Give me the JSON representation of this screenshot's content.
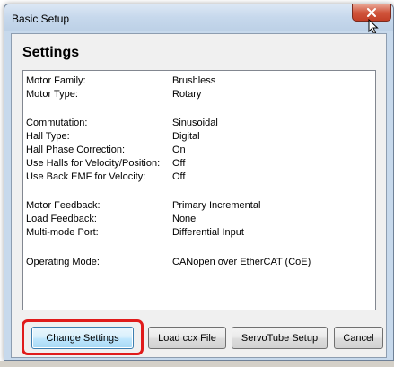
{
  "window": {
    "title": "Basic Setup"
  },
  "dialog": {
    "heading": "Settings"
  },
  "settings": [
    {
      "label": "Motor Family:",
      "value": "Brushless"
    },
    {
      "label": "Motor Type:",
      "value": "Rotary"
    },
    {
      "label": "Commutation:",
      "value": "Sinusoidal"
    },
    {
      "label": "Hall Type:",
      "value": "Digital"
    },
    {
      "label": "Hall Phase Correction:",
      "value": "On"
    },
    {
      "label": "Use Halls for Velocity/Position:",
      "value": "Off"
    },
    {
      "label": "Use Back EMF for Velocity:",
      "value": "Off"
    },
    {
      "label": "Motor Feedback:",
      "value": "Primary Incremental"
    },
    {
      "label": "Load Feedback:",
      "value": "None"
    },
    {
      "label": "Multi-mode Port:",
      "value": "Differential Input"
    },
    {
      "label": "Operating Mode:",
      "value": "CANopen over EtherCAT (CoE)"
    }
  ],
  "buttons": {
    "change_settings": "Change Settings",
    "load_ccx": "Load ccx File",
    "servotube": "ServoTube Setup",
    "cancel": "Cancel"
  },
  "colors": {
    "highlight": "#e01b1b",
    "close_button": "#c33f27",
    "title_bar": "#c6d8ec"
  },
  "icons": [
    "close-icon",
    "mouse-cursor-icon"
  ]
}
